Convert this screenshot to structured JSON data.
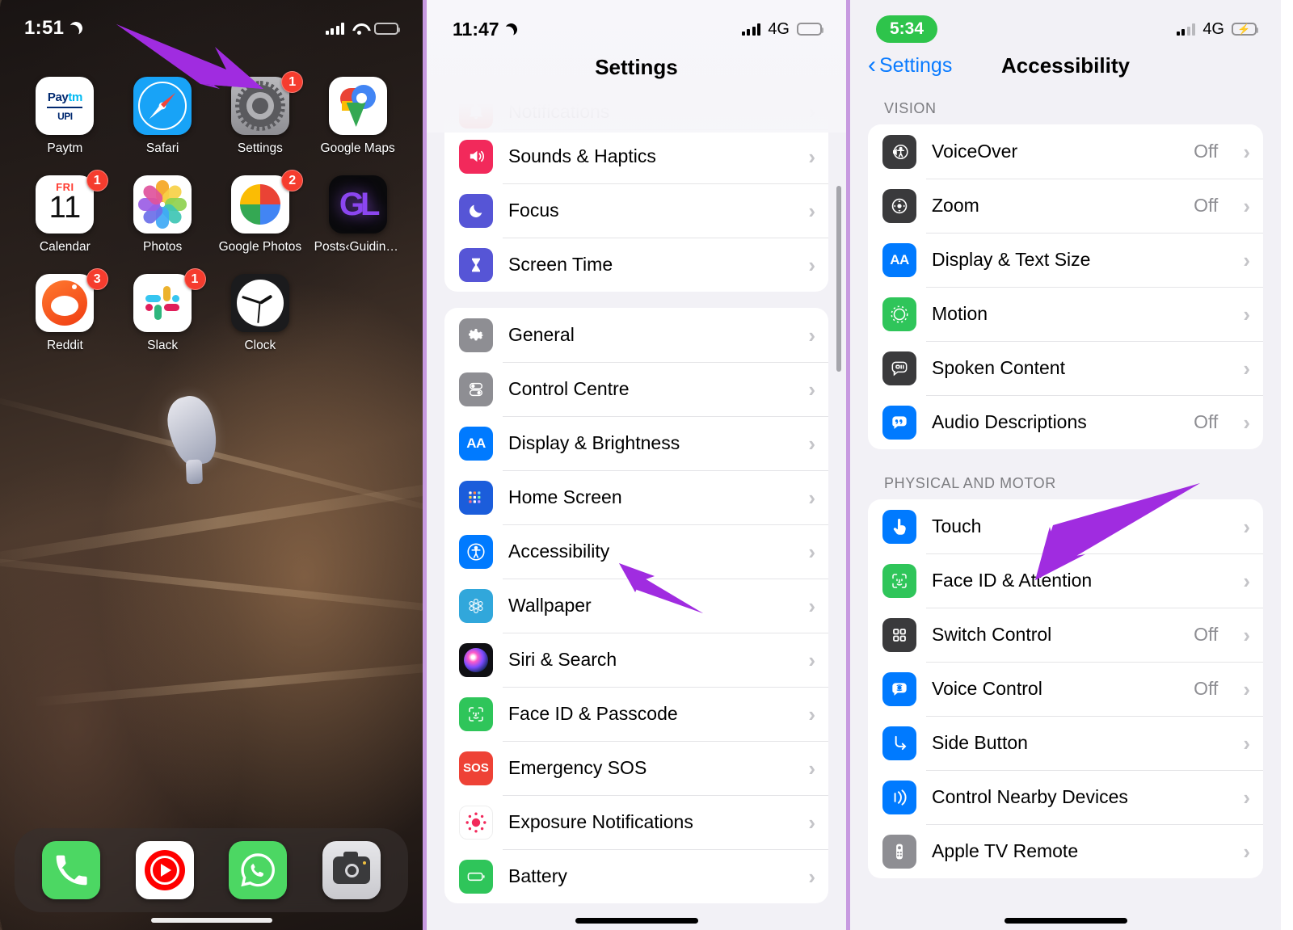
{
  "panels": {
    "home": {
      "status": {
        "time": "1:51",
        "moon_icon": "crescent-moon-icon",
        "signal": "signal-bars-icon",
        "wifi": "wifi-icon",
        "battery": "battery-icon"
      },
      "apps": [
        {
          "name": "Paytm",
          "icon": "paytm-icon",
          "badge": ""
        },
        {
          "name": "Safari",
          "icon": "safari-icon",
          "badge": ""
        },
        {
          "name": "Settings",
          "icon": "settings-gear-icon",
          "badge": "1"
        },
        {
          "name": "Google Maps",
          "icon": "google-maps-icon",
          "badge": ""
        },
        {
          "name": "Calendar",
          "icon": "calendar-icon",
          "badge": "1",
          "cal_day": "FRI",
          "cal_date": "11"
        },
        {
          "name": "Photos",
          "icon": "photos-icon",
          "badge": ""
        },
        {
          "name": "Google Photos",
          "icon": "google-photos-icon",
          "badge": "2"
        },
        {
          "name": "Posts‹Guiding…",
          "icon": "guiding-tech-icon",
          "badge": ""
        },
        {
          "name": "Reddit",
          "icon": "reddit-icon",
          "badge": "3"
        },
        {
          "name": "Slack",
          "icon": "slack-icon",
          "badge": "1"
        },
        {
          "name": "Clock",
          "icon": "clock-icon",
          "badge": ""
        }
      ],
      "dock": [
        {
          "name": "Phone",
          "icon": "phone-icon"
        },
        {
          "name": "YouTube Music",
          "icon": "youtube-music-icon"
        },
        {
          "name": "WhatsApp",
          "icon": "whatsapp-icon"
        },
        {
          "name": "Camera",
          "icon": "camera-icon"
        }
      ],
      "arrow_annotation": "arrow-pointing-to-settings-app"
    },
    "settings": {
      "status": {
        "time": "11:47",
        "moon_icon": "crescent-moon-icon",
        "signal": "signal-bars-icon",
        "network": "4G",
        "battery": "battery-icon"
      },
      "title": "Settings",
      "groups": [
        {
          "rows": [
            {
              "label": "Notifications",
              "icon": "notifications-bell-icon",
              "color": "#ef4136",
              "glyph": "🔔",
              "value": "",
              "partial": true
            },
            {
              "label": "Sounds & Haptics",
              "icon": "sounds-speaker-icon",
              "color": "#f2295b",
              "glyph": "🔊",
              "value": ""
            },
            {
              "label": "Focus",
              "icon": "focus-moon-icon",
              "color": "#5655d6",
              "glyph": "☾",
              "value": ""
            },
            {
              "label": "Screen Time",
              "icon": "screen-time-hourglass-icon",
              "color": "#5655d6",
              "glyph": "⌛",
              "value": ""
            }
          ]
        },
        {
          "rows": [
            {
              "label": "General",
              "icon": "general-gear-icon",
              "color": "#8e8e93",
              "glyph": "⚙",
              "value": ""
            },
            {
              "label": "Control Centre",
              "icon": "control-centre-icon",
              "color": "#8e8e93",
              "glyph": "☰",
              "value": ""
            },
            {
              "label": "Display & Brightness",
              "icon": "display-brightness-icon",
              "color": "#007aff",
              "glyph": "AA",
              "value": ""
            },
            {
              "label": "Home Screen",
              "icon": "home-screen-grid-icon",
              "color": "#1b5ddb",
              "glyph": "☷",
              "value": ""
            },
            {
              "label": "Accessibility",
              "icon": "accessibility-person-icon",
              "color": "#007aff",
              "glyph": "Ⓔ",
              "value": ""
            },
            {
              "label": "Wallpaper",
              "icon": "wallpaper-flower-icon",
              "color": "#31a7db",
              "glyph": "✿",
              "value": ""
            },
            {
              "label": "Siri & Search",
              "icon": "siri-orb-icon",
              "color": "#1a1a1f",
              "glyph": "◉",
              "value": ""
            },
            {
              "label": "Face ID & Passcode",
              "icon": "face-id-icon",
              "color": "#2fc55a",
              "glyph": "☺",
              "value": ""
            },
            {
              "label": "Emergency SOS",
              "icon": "emergency-sos-icon",
              "color": "#ee4236",
              "glyph": "SOS",
              "value": ""
            },
            {
              "label": "Exposure Notifications",
              "icon": "exposure-notifications-icon",
              "color": "#ffffff",
              "glyph": "●",
              "value": ""
            },
            {
              "label": "Battery",
              "icon": "battery-green-icon",
              "color": "#2fc55a",
              "glyph": "▭",
              "value": ""
            }
          ]
        }
      ],
      "arrow_annotation": "arrow-pointing-to-accessibility-row"
    },
    "accessibility": {
      "status": {
        "time": "5:34",
        "signal": "signal-bars-icon",
        "network": "4G",
        "battery": "battery-charging-icon"
      },
      "back_label": "Settings",
      "back_icon": "chevron-left-icon",
      "title": "Accessibility",
      "sections": [
        {
          "header": "VISION",
          "rows": [
            {
              "label": "VoiceOver",
              "icon": "voiceover-icon",
              "color": "#3a3a3c",
              "glyph": "Ⓔ",
              "value": "Off"
            },
            {
              "label": "Zoom",
              "icon": "zoom-magnifier-icon",
              "color": "#3a3a3c",
              "glyph": "⊕",
              "value": "Off"
            },
            {
              "label": "Display & Text Size",
              "icon": "display-text-size-icon",
              "color": "#007aff",
              "glyph": "AA",
              "value": ""
            },
            {
              "label": "Motion",
              "icon": "motion-icon",
              "color": "#2fc55a",
              "glyph": "◎",
              "value": ""
            },
            {
              "label": "Spoken Content",
              "icon": "spoken-content-icon",
              "color": "#3a3a3c",
              "glyph": "💬",
              "value": ""
            },
            {
              "label": "Audio Descriptions",
              "icon": "audio-descriptions-icon",
              "color": "#007aff",
              "glyph": "”",
              "value": "Off"
            }
          ]
        },
        {
          "header": "PHYSICAL AND MOTOR",
          "rows": [
            {
              "label": "Touch",
              "icon": "touch-hand-icon",
              "color": "#007aff",
              "glyph": "☝",
              "value": ""
            },
            {
              "label": "Face ID & Attention",
              "icon": "face-id-attention-icon",
              "color": "#2fc55a",
              "glyph": "☺",
              "value": ""
            },
            {
              "label": "Switch Control",
              "icon": "switch-control-icon",
              "color": "#3a3a3c",
              "glyph": "☷",
              "value": "Off"
            },
            {
              "label": "Voice Control",
              "icon": "voice-control-icon",
              "color": "#007aff",
              "glyph": "💬",
              "value": "Off"
            },
            {
              "label": "Side Button",
              "icon": "side-button-icon",
              "color": "#007aff",
              "glyph": "↩",
              "value": ""
            },
            {
              "label": "Control Nearby Devices",
              "icon": "control-nearby-devices-icon",
              "color": "#007aff",
              "glyph": "⧹))",
              "value": ""
            },
            {
              "label": "Apple TV Remote",
              "icon": "apple-tv-remote-icon",
              "color": "#8e8e93",
              "glyph": "▯",
              "value": ""
            }
          ]
        }
      ],
      "arrow_annotation": "arrow-pointing-to-touch-row"
    }
  },
  "colors": {
    "accent_blue": "#007aff",
    "arrow_purple": "#a02ce0",
    "divider_purple": "#c79ae0",
    "ios_background": "#f2f1f6",
    "secondary_text": "#8e8e93"
  }
}
